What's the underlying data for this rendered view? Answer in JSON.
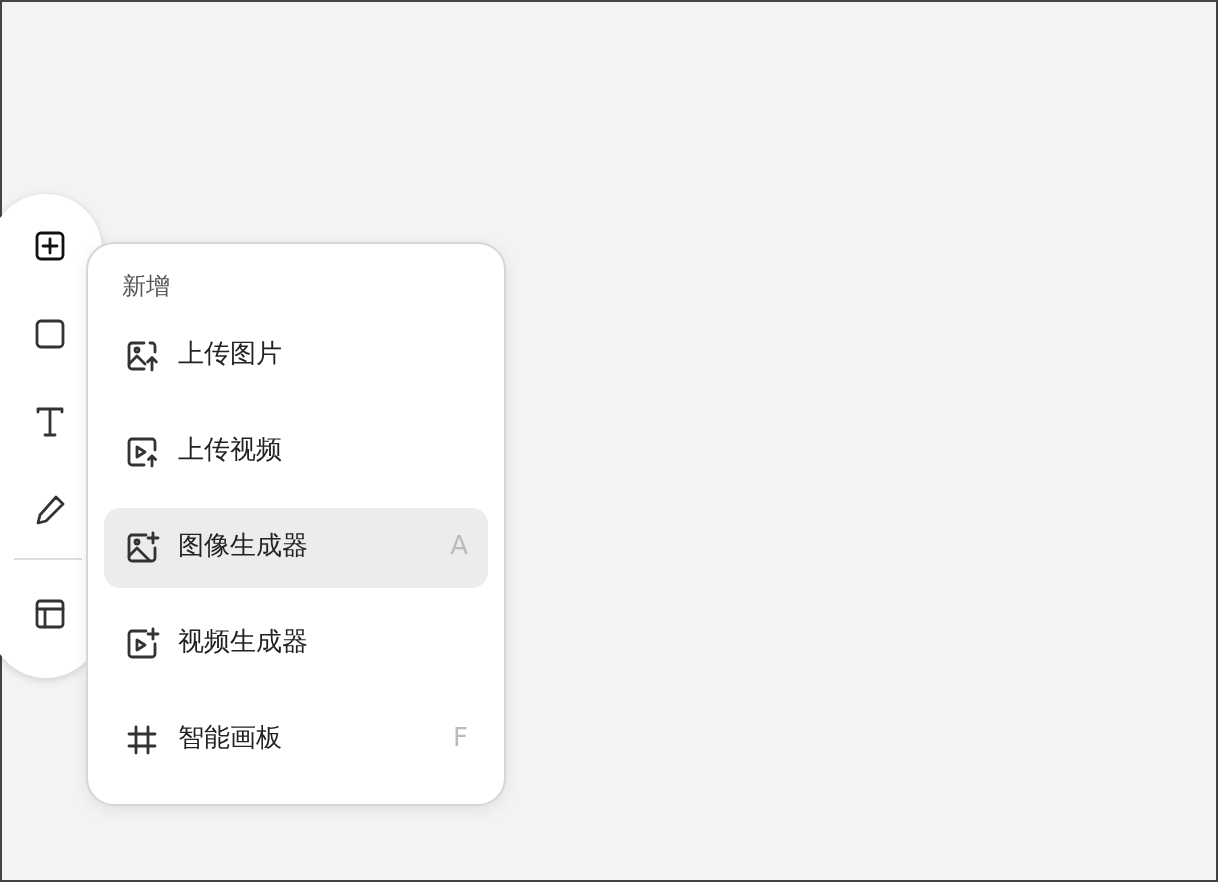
{
  "toolbar": {
    "tools": [
      {
        "kind": "add",
        "selected": true
      },
      {
        "kind": "rectangle",
        "selected": false
      },
      {
        "kind": "text",
        "selected": false
      },
      {
        "kind": "pencil",
        "selected": false
      },
      {
        "kind": "divider"
      },
      {
        "kind": "layout",
        "selected": false
      }
    ]
  },
  "menu": {
    "title": "新增",
    "items": [
      {
        "kind": "image-upload",
        "label": "上传图片",
        "selected": false
      },
      {
        "kind": "video-upload",
        "label": "上传视频",
        "selected": false
      },
      {
        "kind": "image-spark",
        "label": "图像生成器",
        "shortcut": "A",
        "selected": true
      },
      {
        "kind": "video-spark",
        "label": "视频生成器",
        "selected": false
      },
      {
        "kind": "hash",
        "label": "智能画板",
        "shortcut": "F",
        "selected": false
      }
    ]
  }
}
